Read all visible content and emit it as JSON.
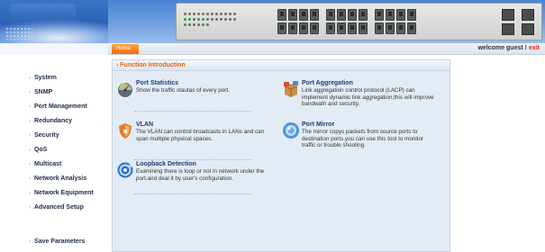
{
  "header": {
    "welcome_prefix": "welcome",
    "user": "guest",
    "separator": "!",
    "exit_label": "exit"
  },
  "nav": {
    "home_label": "Home"
  },
  "sidebar": {
    "items": [
      {
        "label": "System"
      },
      {
        "label": "SNMP"
      },
      {
        "label": "Port Management"
      },
      {
        "label": "Redundancy"
      },
      {
        "label": "Security"
      },
      {
        "label": "QoS"
      },
      {
        "label": "Multicast"
      },
      {
        "label": "Network Analysis"
      },
      {
        "label": "Network Equipment"
      },
      {
        "label": "Advanced Setup"
      }
    ],
    "save_label": "Save Parameters",
    "arrow_glyph": "›"
  },
  "main": {
    "title": "› Function Introduction",
    "features": [
      {
        "name": "Port Statistics",
        "desc": "Show the traffic stautas of every port.",
        "icon": "gauge-icon"
      },
      {
        "name": "Port Aggregation",
        "desc": "Link aggregation control protocol (LACP) can implement dynamic link aggregation,this will improve bandwath and security.",
        "icon": "box-icon"
      },
      {
        "name": "VLAN",
        "desc": "The VLAN can control broadcasts in LANs and can span multiple physical spaces.",
        "icon": "shield-icon"
      },
      {
        "name": "Port Mirror",
        "desc": "The mirror copys packets from source ports to destination ports,you can use this tool to monitor traffic or trouble shooting.",
        "icon": "mirror-icon"
      },
      {
        "name": "Loopback Detection",
        "desc": "Examining there is loop or not in network under the port,and deal it by user's configuration.",
        "icon": "loop-icon"
      }
    ]
  },
  "colors": {
    "accent_orange": "#e8630c",
    "exit_red": "#e0301e",
    "link_blue": "#1c3c7a"
  }
}
